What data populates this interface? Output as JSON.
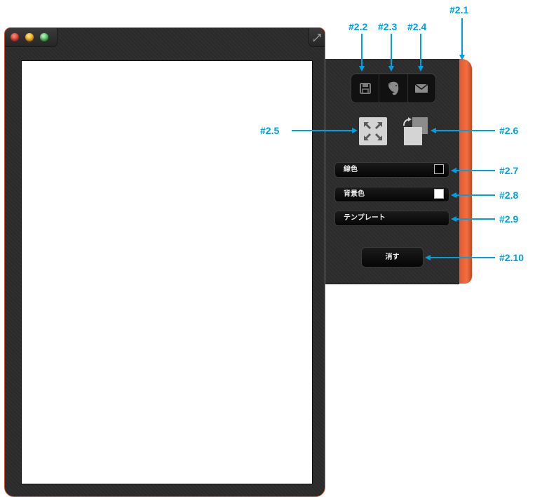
{
  "window": {
    "controls": [
      "close-button",
      "minimize-button",
      "zoom-button"
    ]
  },
  "panel": {
    "share_icons": [
      "save-icon",
      "evernote-icon",
      "mail-icon"
    ],
    "tool_icons": [
      "fit-screen-icon",
      "rotate-canvas-icon"
    ],
    "line_color": {
      "label": "線色",
      "value": "#000000"
    },
    "bg_color": {
      "label": "背景色",
      "value": "#ffffff"
    },
    "template": {
      "label": "テンプレート"
    },
    "clear": {
      "label": "消す"
    }
  },
  "annotations": {
    "a1": "#2.1",
    "a2": "#2.2",
    "a3": "#2.3",
    "a4": "#2.4",
    "a5": "#2.5",
    "a6": "#2.6",
    "a7": "#2.7",
    "a8": "#2.8",
    "a9": "#2.9",
    "a10": "#2.10"
  },
  "colors": {
    "accent": "#00a0e0",
    "frame": "#d2522c",
    "panel": "#2b2b2b",
    "canvas": "#ffffff"
  }
}
